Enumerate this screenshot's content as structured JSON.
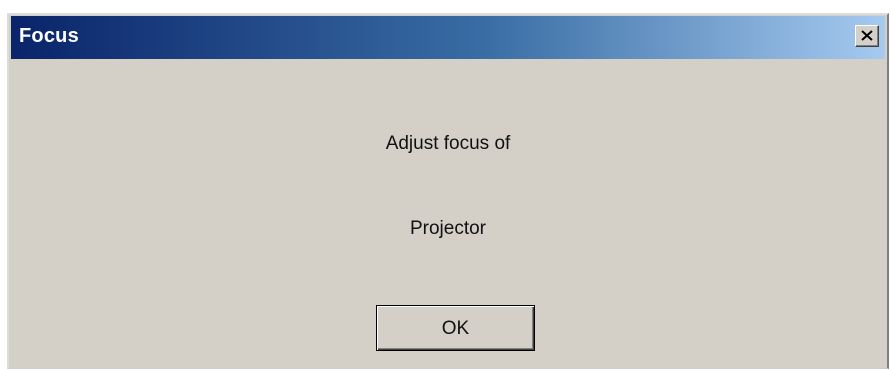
{
  "window": {
    "title": "Focus",
    "close_icon": "close-icon",
    "titlebar_colors": [
      "#0a246a",
      "#3a6ea5",
      "#a6caf0"
    ],
    "background": "#d4d0c8"
  },
  "message": {
    "line1": "Adjust focus of",
    "line2": "Projector"
  },
  "buttons": {
    "ok_label": "OK"
  }
}
